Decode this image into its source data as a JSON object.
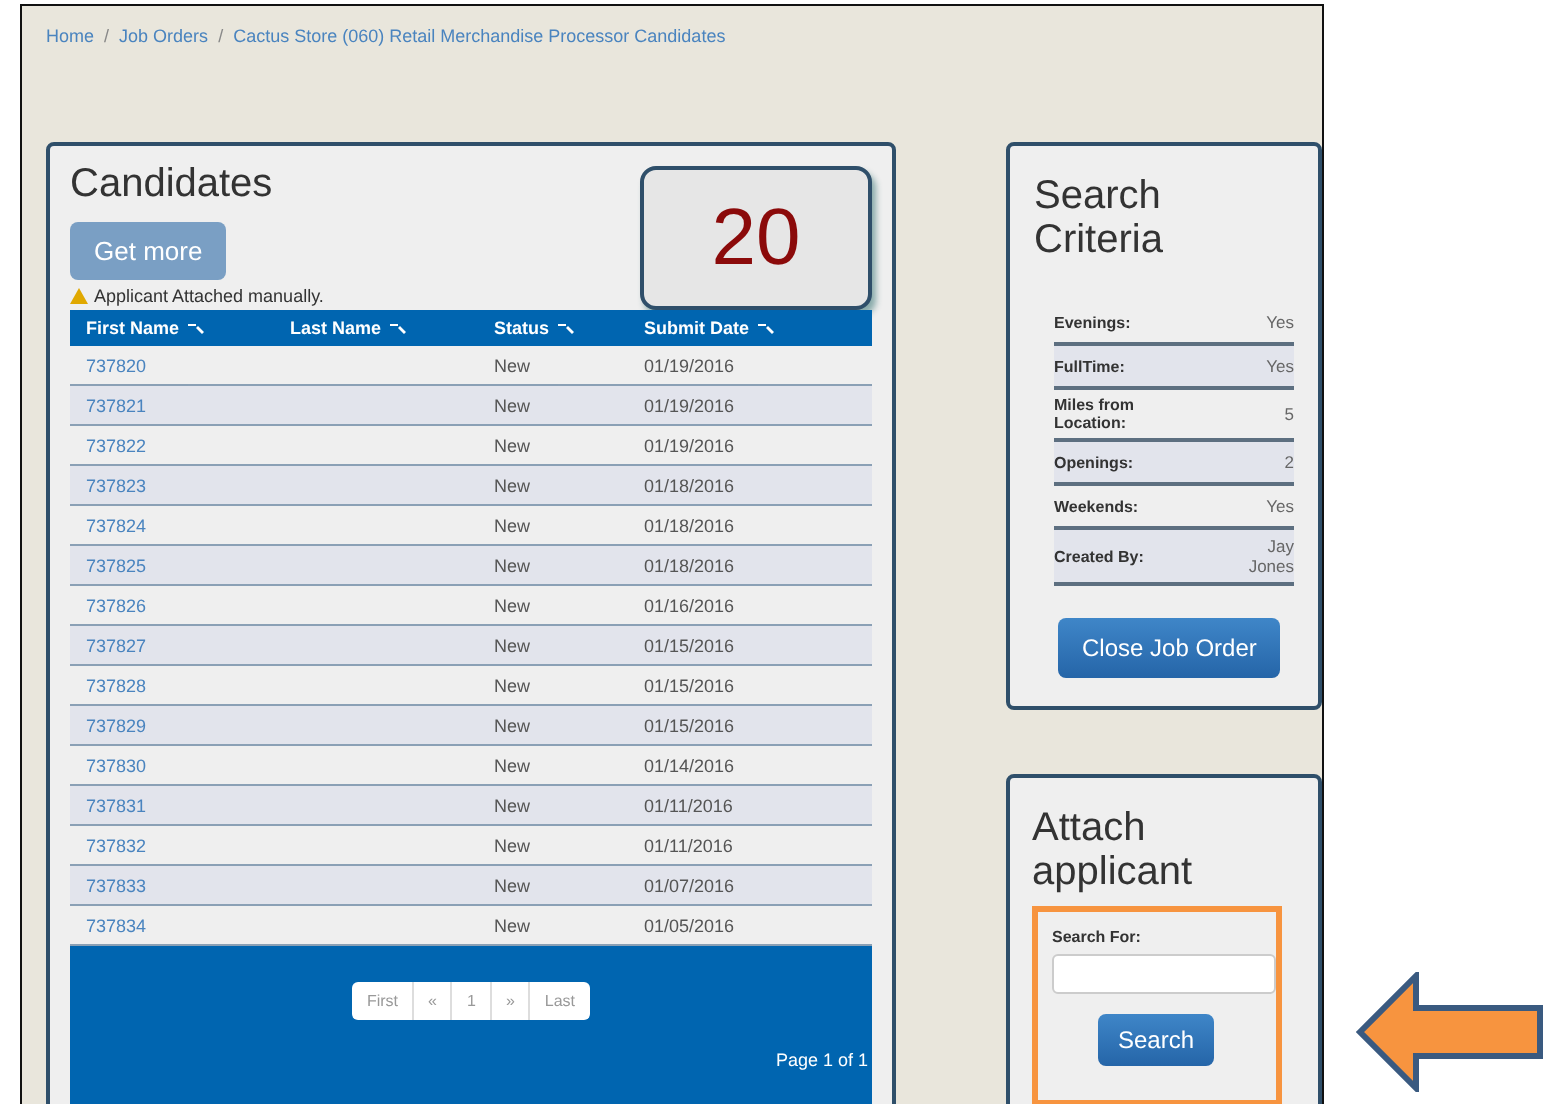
{
  "breadcrumb_separator": "/",
  "breadcrumb": [
    "Home",
    "Job Orders",
    "Cactus Store (060) Retail Merchandise Processor Candidates"
  ],
  "candidates": {
    "title": "Candidates",
    "get_more": "Get more",
    "notice": "Applicant Attached manually.",
    "count": "20",
    "columns": [
      "First Name",
      "Last Name",
      "Status",
      "Submit Date"
    ],
    "rows": [
      {
        "first_name": "737820",
        "status": "New",
        "submit_date": "01/19/2016"
      },
      {
        "first_name": "737821",
        "status": "New",
        "submit_date": "01/19/2016"
      },
      {
        "first_name": "737822",
        "status": "New",
        "submit_date": "01/19/2016"
      },
      {
        "first_name": "737823",
        "status": "New",
        "submit_date": "01/18/2016"
      },
      {
        "first_name": "737824",
        "status": "New",
        "submit_date": "01/18/2016"
      },
      {
        "first_name": "737825",
        "status": "New",
        "submit_date": "01/18/2016"
      },
      {
        "first_name": "737826",
        "status": "New",
        "submit_date": "01/16/2016"
      },
      {
        "first_name": "737827",
        "status": "New",
        "submit_date": "01/15/2016"
      },
      {
        "first_name": "737828",
        "status": "New",
        "submit_date": "01/15/2016"
      },
      {
        "first_name": "737829",
        "status": "New",
        "submit_date": "01/15/2016"
      },
      {
        "first_name": "737830",
        "status": "New",
        "submit_date": "01/14/2016"
      },
      {
        "first_name": "737831",
        "status": "New",
        "submit_date": "01/11/2016"
      },
      {
        "first_name": "737832",
        "status": "New",
        "submit_date": "01/11/2016"
      },
      {
        "first_name": "737833",
        "status": "New",
        "submit_date": "01/07/2016"
      },
      {
        "first_name": "737834",
        "status": "New",
        "submit_date": "01/05/2016"
      }
    ],
    "pagination": [
      "First",
      "«",
      "1",
      "»",
      "Last"
    ],
    "page_label": "Page 1 of 1"
  },
  "criteria": {
    "title": "Search Criteria",
    "rows": [
      {
        "label": "Evenings:",
        "value": "Yes"
      },
      {
        "label": "FullTime:",
        "value": "Yes"
      },
      {
        "label": "Miles from Location:",
        "value": "5"
      },
      {
        "label": "Openings:",
        "value": "2"
      },
      {
        "label": "Weekends:",
        "value": "Yes"
      },
      {
        "label": "Created By:",
        "value": "Jay Jones"
      }
    ],
    "button": "Close Job Order"
  },
  "attach": {
    "title": "Attach applicant",
    "search_label": "Search For:",
    "button": "Search"
  }
}
